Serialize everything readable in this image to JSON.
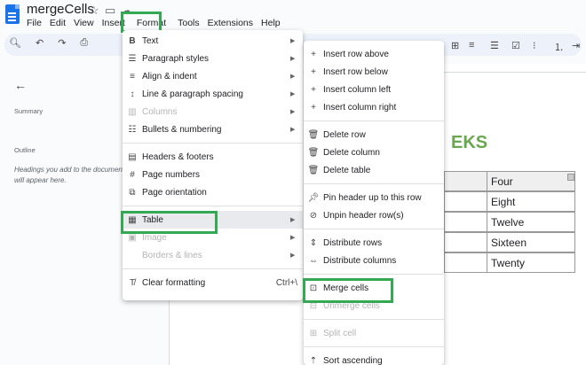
{
  "app": {
    "title": "mergeCells",
    "star_icon": "star-icon",
    "move_icon": "folder-icon",
    "cloud_icon": "cloud-icon",
    "menus": [
      "File",
      "Edit",
      "View",
      "Insert",
      "Format",
      "Tools",
      "Extensions",
      "Help"
    ]
  },
  "left_panel": {
    "back_icon": "arrow-left-icon",
    "summary_label": "Summary",
    "outline_label": "Outline",
    "outline_hint": "Headings you add to the document will appear here."
  },
  "document": {
    "heading_fragment": "EKS",
    "table_column_header": "Four",
    "table_values": [
      "Eight",
      "Twelve",
      "Sixteen",
      "Twenty"
    ]
  },
  "format_menu": {
    "items": [
      {
        "icon": "bold-icon",
        "label": "Text",
        "submenu": true,
        "disabled": false
      },
      {
        "icon": "paragraph-styles-icon",
        "label": "Paragraph styles",
        "submenu": true,
        "disabled": false
      },
      {
        "icon": "align-icon",
        "label": "Align & indent",
        "submenu": true,
        "disabled": false
      },
      {
        "icon": "line-spacing-icon",
        "label": "Line & paragraph spacing",
        "submenu": true,
        "disabled": false
      },
      {
        "icon": "columns-icon",
        "label": "Columns",
        "submenu": true,
        "disabled": true
      },
      {
        "icon": "bullets-icon",
        "label": "Bullets & numbering",
        "submenu": true,
        "disabled": false
      },
      {
        "icon": "headers-footers-icon",
        "label": "Headers & footers",
        "submenu": false,
        "disabled": false
      },
      {
        "icon": "hash-icon",
        "label": "Page numbers",
        "submenu": false,
        "disabled": false
      },
      {
        "icon": "page-orientation-icon",
        "label": "Page orientation",
        "submenu": false,
        "disabled": false
      },
      {
        "icon": "table-icon",
        "label": "Table",
        "submenu": true,
        "disabled": false
      },
      {
        "icon": "image-icon",
        "label": "Image",
        "submenu": true,
        "disabled": true
      },
      {
        "icon": "borders-icon",
        "label": "Borders & lines",
        "submenu": true,
        "disabled": true
      },
      {
        "icon": "clear-formatting-icon",
        "label": "Clear formatting",
        "submenu": false,
        "disabled": false,
        "shortcut": "Ctrl+\\"
      }
    ]
  },
  "table_submenu": {
    "items": [
      {
        "icon": "plus-icon",
        "label": "Insert row above",
        "disabled": false
      },
      {
        "icon": "plus-icon",
        "label": "Insert row below",
        "disabled": false
      },
      {
        "icon": "plus-icon",
        "label": "Insert column left",
        "disabled": false
      },
      {
        "icon": "plus-icon",
        "label": "Insert column right",
        "disabled": false
      },
      {
        "icon": "trash-icon",
        "label": "Delete row",
        "disabled": false
      },
      {
        "icon": "trash-icon",
        "label": "Delete column",
        "disabled": false
      },
      {
        "icon": "trash-icon",
        "label": "Delete table",
        "disabled": false
      },
      {
        "icon": "pin-icon",
        "label": "Pin header up to this row",
        "disabled": false
      },
      {
        "icon": "unpin-icon",
        "label": "Unpin header row(s)",
        "disabled": false
      },
      {
        "icon": "distribute-rows-icon",
        "label": "Distribute rows",
        "disabled": false
      },
      {
        "icon": "distribute-columns-icon",
        "label": "Distribute columns",
        "disabled": false
      },
      {
        "icon": "merge-cells-icon",
        "label": "Merge cells",
        "disabled": false
      },
      {
        "icon": "unmerge-cells-icon",
        "label": "Unmerge cells",
        "disabled": true
      },
      {
        "icon": "split-cell-icon",
        "label": "Split cell",
        "disabled": true
      },
      {
        "icon": "sort-ascending-icon",
        "label": "Sort ascending",
        "disabled": false
      }
    ]
  },
  "colors": {
    "highlight": "#34a853",
    "heading_green": "#6aa84f",
    "doc_blue": "#1a73e8"
  }
}
